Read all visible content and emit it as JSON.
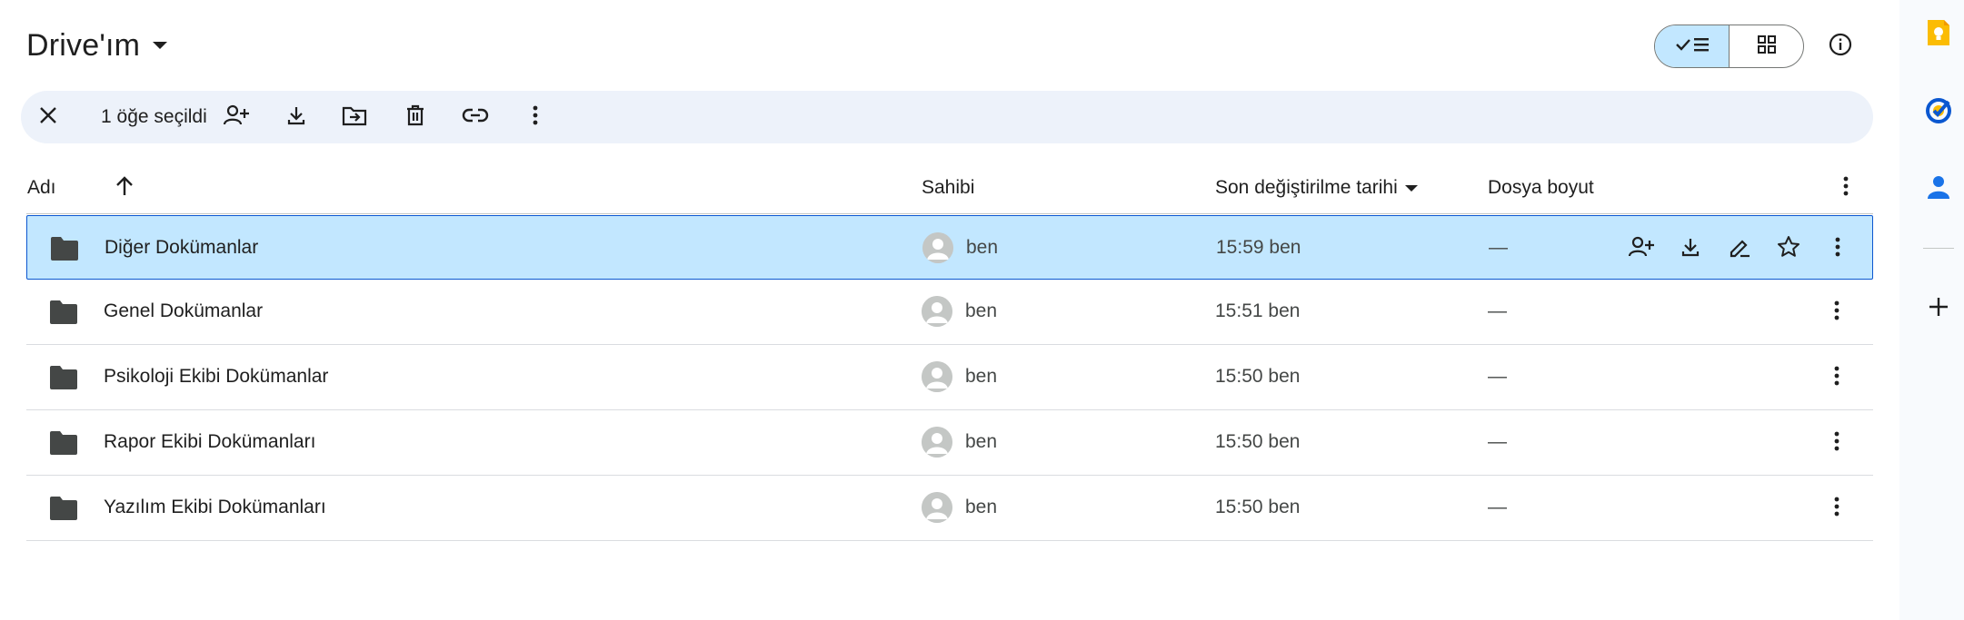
{
  "header": {
    "title": "Drive'ım",
    "view_toggle": {
      "list_icon": "check-list-icon",
      "grid_icon": "grid-icon",
      "active": "list"
    },
    "info_icon": "info-icon"
  },
  "toolbar": {
    "selection_count": "1 öğe seçildi",
    "icons": [
      "close-icon",
      "share-icon",
      "download-icon",
      "move-icon",
      "trash-icon",
      "link-icon",
      "more-vert-icon"
    ]
  },
  "table": {
    "columns": {
      "name": "Adı",
      "owner": "Sahibi",
      "modified": "Son değiştirilme tarihi",
      "size": "Dosya boyut"
    },
    "sort_direction": "ascending",
    "rows": [
      {
        "name": "Diğer Dokümanlar",
        "owner": "ben",
        "modified": "15:59 ben",
        "size": "—",
        "selected": true
      },
      {
        "name": "Genel Dokümanlar",
        "owner": "ben",
        "modified": "15:51 ben",
        "size": "—",
        "selected": false
      },
      {
        "name": "Psikoloji Ekibi Dokümanlar",
        "owner": "ben",
        "modified": "15:50 ben",
        "size": "—",
        "selected": false
      },
      {
        "name": "Rapor Ekibi Dokümanları",
        "owner": "ben",
        "modified": "15:50 ben",
        "size": "—",
        "selected": false
      },
      {
        "name": "Yazılım Ekibi Dokümanları",
        "owner": "ben",
        "modified": "15:50 ben",
        "size": "—",
        "selected": false
      }
    ]
  },
  "side_panel": {
    "apps": [
      "keep-icon",
      "tasks-icon",
      "contacts-icon",
      "add-icon"
    ]
  },
  "colors": {
    "selected_row": "#c2e7ff",
    "selected_border": "#0b57d0",
    "toolbar_bg": "#edf2fa",
    "keep": "#fbbc04",
    "tasks": "#0b57d0",
    "contacts": "#1a73e8"
  }
}
